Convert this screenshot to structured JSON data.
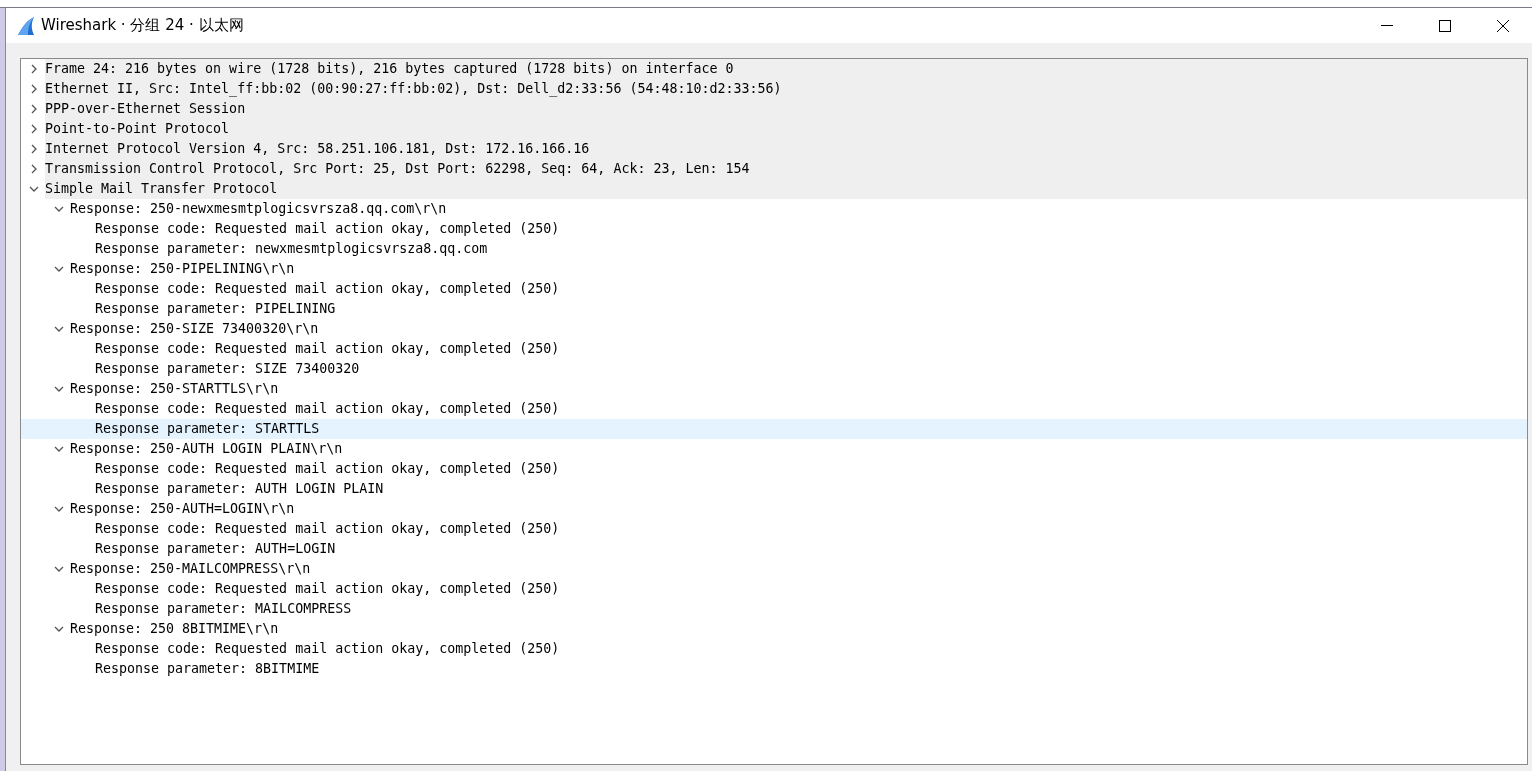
{
  "window": {
    "title": "Wireshark · 分组 24 · 以太网"
  },
  "tree": [
    {
      "text": "Frame 24: 216 bytes on wire (1728 bits), 216 bytes captured (1728 bits) on interface 0",
      "expanded": false,
      "selected": false
    },
    {
      "text": "Ethernet II, Src: Intel_ff:bb:02 (00:90:27:ff:bb:02), Dst: Dell_d2:33:56 (54:48:10:d2:33:56)",
      "expanded": false,
      "selected": false
    },
    {
      "text": "PPP-over-Ethernet Session",
      "expanded": false,
      "selected": false
    },
    {
      "text": "Point-to-Point Protocol",
      "expanded": false,
      "selected": false
    },
    {
      "text": "Internet Protocol Version 4, Src: 58.251.106.181, Dst: 172.16.166.16",
      "expanded": false,
      "selected": false
    },
    {
      "text": "Transmission Control Protocol, Src Port: 25, Dst Port: 62298, Seq: 64, Ack: 23, Len: 154",
      "expanded": false,
      "selected": false
    },
    {
      "text": "Simple Mail Transfer Protocol",
      "expanded": true,
      "selected": false,
      "children": [
        {
          "text": "Response: 250-newxmesmtplogicsvrsza8.qq.com\\r\\n",
          "expanded": true,
          "selected": false,
          "children": [
            {
              "text": "Response code: Requested mail action okay, completed (250)",
              "selected": false
            },
            {
              "text": "Response parameter: newxmesmtplogicsvrsza8.qq.com",
              "selected": false
            }
          ]
        },
        {
          "text": "Response: 250-PIPELINING\\r\\n",
          "expanded": true,
          "selected": false,
          "children": [
            {
              "text": "Response code: Requested mail action okay, completed (250)",
              "selected": false
            },
            {
              "text": "Response parameter: PIPELINING",
              "selected": false
            }
          ]
        },
        {
          "text": "Response: 250-SIZE 73400320\\r\\n",
          "expanded": true,
          "selected": false,
          "children": [
            {
              "text": "Response code: Requested mail action okay, completed (250)",
              "selected": false
            },
            {
              "text": "Response parameter: SIZE 73400320",
              "selected": false
            }
          ]
        },
        {
          "text": "Response: 250-STARTTLS\\r\\n",
          "expanded": true,
          "selected": false,
          "children": [
            {
              "text": "Response code: Requested mail action okay, completed (250)",
              "selected": false
            },
            {
              "text": "Response parameter: STARTTLS",
              "selected": true
            }
          ]
        },
        {
          "text": "Response: 250-AUTH LOGIN PLAIN\\r\\n",
          "expanded": true,
          "selected": false,
          "children": [
            {
              "text": "Response code: Requested mail action okay, completed (250)",
              "selected": false
            },
            {
              "text": "Response parameter: AUTH LOGIN PLAIN",
              "selected": false
            }
          ]
        },
        {
          "text": "Response: 250-AUTH=LOGIN\\r\\n",
          "expanded": true,
          "selected": false,
          "children": [
            {
              "text": "Response code: Requested mail action okay, completed (250)",
              "selected": false
            },
            {
              "text": "Response parameter: AUTH=LOGIN",
              "selected": false
            }
          ]
        },
        {
          "text": "Response: 250-MAILCOMPRESS\\r\\n",
          "expanded": true,
          "selected": false,
          "children": [
            {
              "text": "Response code: Requested mail action okay, completed (250)",
              "selected": false
            },
            {
              "text": "Response parameter: MAILCOMPRESS",
              "selected": false
            }
          ]
        },
        {
          "text": "Response: 250 8BITMIME\\r\\n",
          "expanded": true,
          "selected": false,
          "children": [
            {
              "text": "Response code: Requested mail action okay, completed (250)",
              "selected": false
            },
            {
              "text": "Response parameter: 8BITMIME",
              "selected": false
            }
          ]
        }
      ]
    }
  ]
}
